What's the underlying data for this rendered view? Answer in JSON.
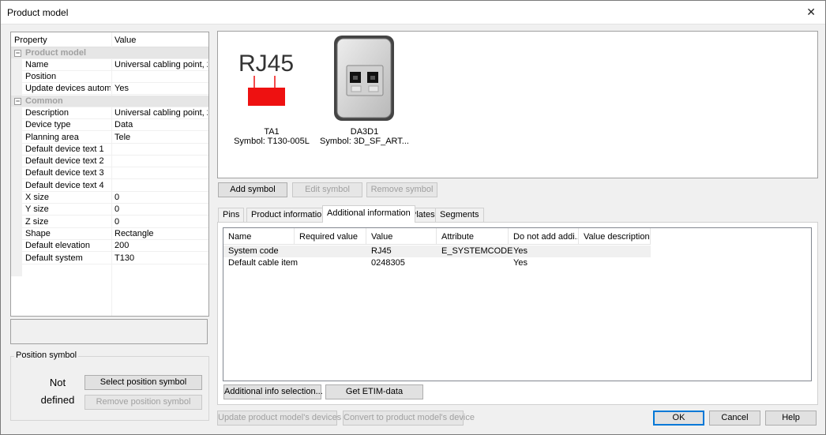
{
  "window": {
    "title": "Product model",
    "close_glyph": "✕"
  },
  "properties": {
    "headers": {
      "property": "Property",
      "value": "Value"
    },
    "categories": [
      {
        "name": "Product model",
        "toggle": "⊟",
        "rows": [
          {
            "name": "Name",
            "value": "Universal cabling point, 2..."
          },
          {
            "name": "Position",
            "value": ""
          },
          {
            "name": "Update devices autom...",
            "value": "Yes"
          }
        ]
      },
      {
        "name": "Common",
        "toggle": "⊟",
        "rows": [
          {
            "name": "Description",
            "value": "Universal cabling point, 2..."
          },
          {
            "name": "Device type",
            "value": "Data"
          },
          {
            "name": "Planning area",
            "value": "Tele"
          },
          {
            "name": "Default device text 1",
            "value": ""
          },
          {
            "name": "Default device text 2",
            "value": ""
          },
          {
            "name": "Default device text 3",
            "value": ""
          },
          {
            "name": "Default device text 4",
            "value": ""
          },
          {
            "name": "X size",
            "value": "0"
          },
          {
            "name": "Y size",
            "value": "0"
          },
          {
            "name": "Z size",
            "value": "0"
          },
          {
            "name": "Shape",
            "value": "Rectangle"
          },
          {
            "name": "Default elevation",
            "value": "200"
          },
          {
            "name": "Default system",
            "value": "T130"
          }
        ]
      }
    ]
  },
  "position_symbol": {
    "legend": "Position symbol",
    "status_line1": "Not",
    "status_line2": "defined",
    "select_button": "Select position symbol",
    "remove_button": "Remove position symbol"
  },
  "symbols": [
    {
      "graphic_text": "RJ45",
      "name": "TA1",
      "symbol": "Symbol: T130-005L",
      "color": "#ee1111"
    },
    {
      "name": "DA3D1",
      "symbol": "Symbol: 3D_SF_ART..."
    }
  ],
  "symbol_buttons": {
    "add": "Add symbol",
    "edit": "Edit symbol",
    "remove": "Remove symbol"
  },
  "tabs": [
    "Pins",
    "Product information",
    "Additional information",
    "Plates",
    "Segments"
  ],
  "active_tab": "Additional information",
  "info_table": {
    "columns": [
      "Name",
      "Required value",
      "Value",
      "Attribute",
      "Do not add addi...",
      "Value description"
    ],
    "rows": [
      [
        "System code",
        "",
        "RJ45",
        "E_SYSTEMCODE",
        "Yes",
        ""
      ],
      [
        "Default cable item",
        "",
        "0248305",
        "",
        "Yes",
        ""
      ]
    ]
  },
  "info_buttons": {
    "selection": "Additional info selection...",
    "etim": "Get ETIM-data"
  },
  "footer": {
    "update_devices": "Update product model's devices",
    "convert": "Convert to product model's device",
    "ok": "OK",
    "cancel": "Cancel",
    "help": "Help"
  }
}
